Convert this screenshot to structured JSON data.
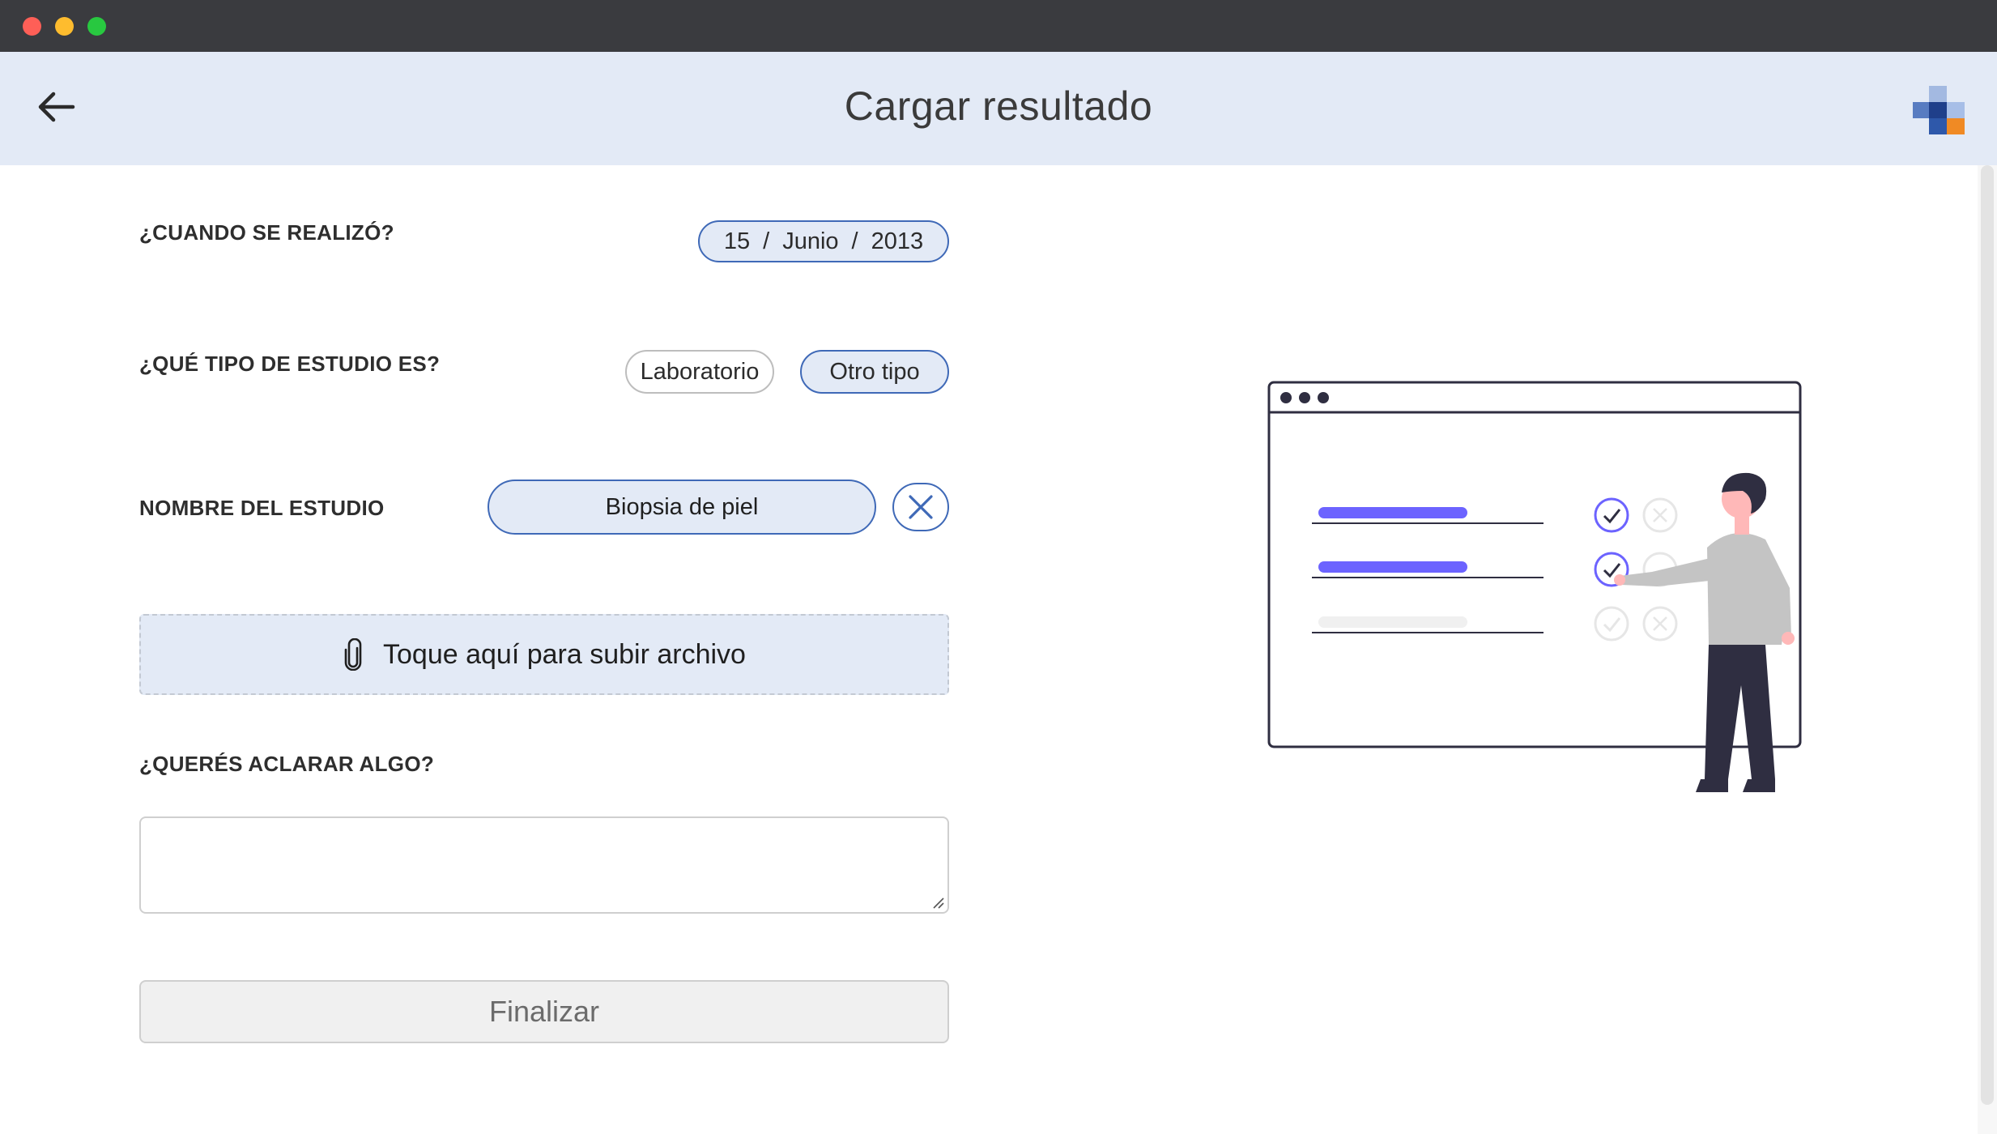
{
  "window": {
    "controls": [
      "close",
      "minimize",
      "maximize"
    ]
  },
  "header": {
    "title": "Cargar resultado",
    "back_icon": "arrow-left-icon",
    "logo_icon": "medical-cross-logo"
  },
  "form": {
    "date": {
      "label": "¿CUANDO SE REALIZÓ?",
      "day": "15",
      "month": "Junio",
      "year": "2013",
      "separator": "/"
    },
    "study_type": {
      "label": "¿QUÉ TIPO DE ESTUDIO ES?",
      "options": [
        "Laboratorio",
        "Otro tipo"
      ],
      "selected": "Otro tipo"
    },
    "study_name": {
      "label": "NOMBRE DEL ESTUDIO",
      "value": "Biopsia de piel",
      "clear_icon": "close-icon"
    },
    "upload": {
      "label": "Toque aquí para subir archivo",
      "icon": "paperclip-icon"
    },
    "notes": {
      "label": "¿QUERÉS ACLARAR ALGO?",
      "value": "",
      "placeholder": ""
    },
    "submit": {
      "label": "Finalizar"
    }
  },
  "colors": {
    "accent": "#3f69b7",
    "header_bg": "#e3eaf6",
    "illustration_accent": "#6c63ff",
    "text_dark": "#2e2e2e"
  }
}
